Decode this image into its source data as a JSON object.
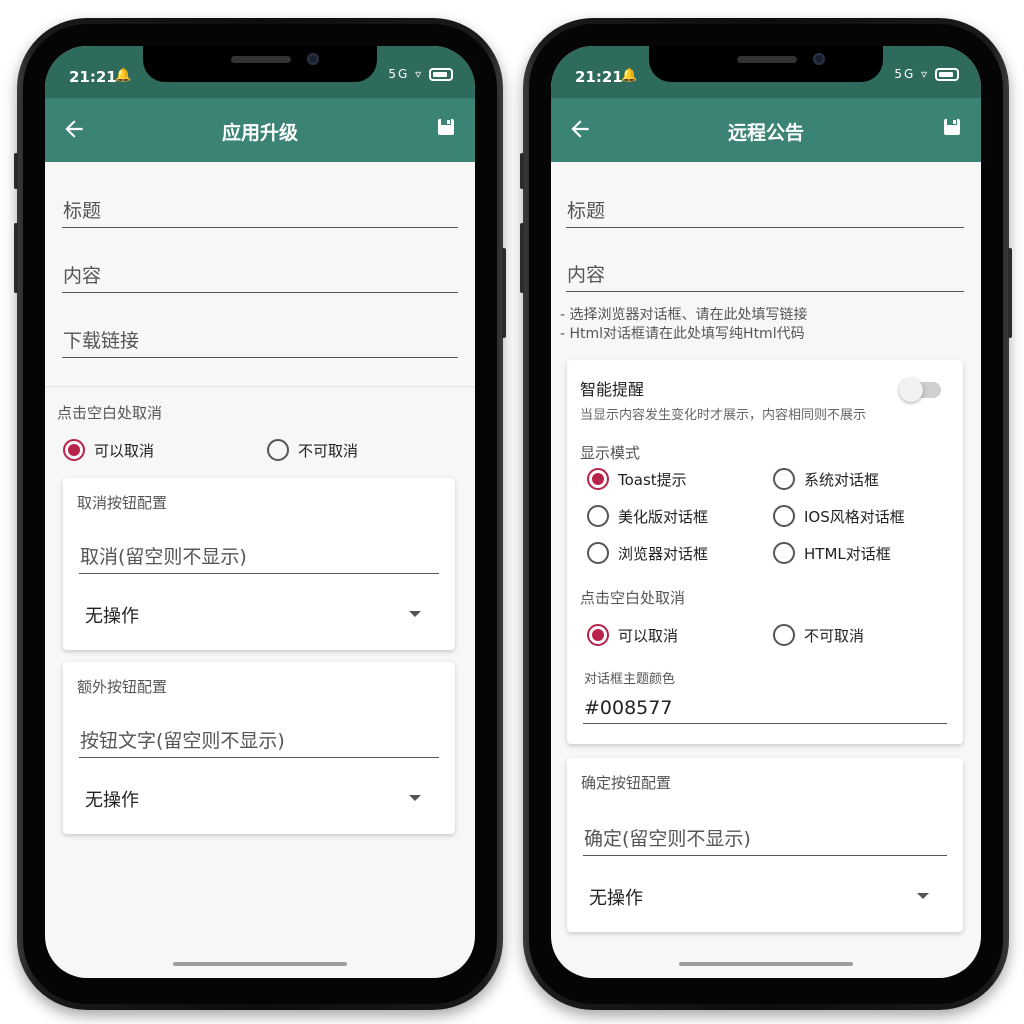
{
  "status": {
    "time": "21:21",
    "network": "5G"
  },
  "left_screen": {
    "title": "应用升级",
    "fields": {
      "title": "标题",
      "content": "内容",
      "download_link": "下载链接"
    },
    "dismiss_label": "点击空白处取消",
    "dismiss_options": [
      "可以取消",
      "不可取消"
    ],
    "dismiss_selected": 0,
    "cancel_card": {
      "title": "取消按钮配置",
      "placeholder": "取消(留空则不显示)",
      "action": "无操作"
    },
    "extra_card": {
      "title": "额外按钮配置",
      "placeholder": "按钮文字(留空则不显示)",
      "action": "无操作"
    }
  },
  "right_screen": {
    "title": "远程公告",
    "fields": {
      "title": "标题",
      "content": "内容"
    },
    "hint_lines": [
      "- 选择浏览器对话框、请在此处填写链接",
      "- Html对话框请在此处填写纯Html代码"
    ],
    "smart_card": {
      "smart_title": "智能提醒",
      "smart_desc": "当显示内容发生变化时才展示，内容相同则不展示",
      "smart_enabled": false,
      "mode_label": "显示模式",
      "modes": [
        "Toast提示",
        "系统对话框",
        "美化版对话框",
        "IOS风格对话框",
        "浏览器对话框",
        "HTML对话框"
      ],
      "mode_selected": 0,
      "dismiss_label": "点击空白处取消",
      "dismiss_options": [
        "可以取消",
        "不可取消"
      ],
      "dismiss_selected": 0,
      "theme_label": "对话框主题颜色",
      "theme_value": "#008577"
    },
    "confirm_card": {
      "title": "确定按钮配置",
      "placeholder": "确定(留空则不显示)",
      "action": "无操作"
    }
  },
  "colors": {
    "statusbar": "#2e6b5c",
    "appbar": "#3b8374",
    "radio_accent": "#b8234a"
  }
}
